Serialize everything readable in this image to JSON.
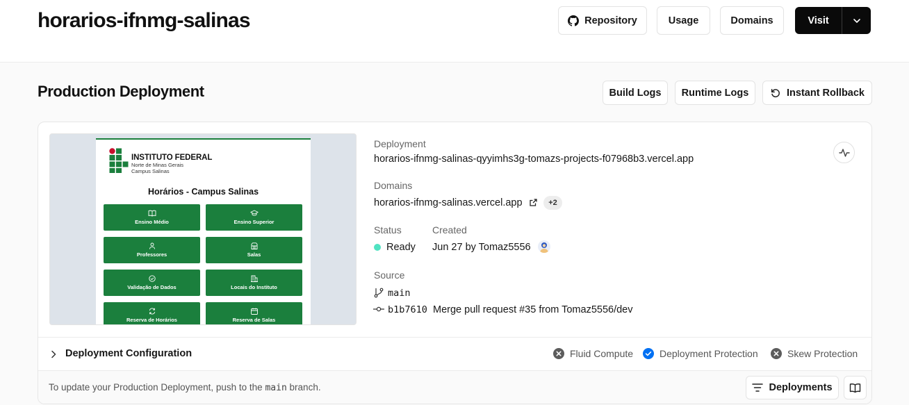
{
  "header": {
    "project_name": "horarios-ifnmg-salinas",
    "repository_label": "Repository",
    "usage_label": "Usage",
    "domains_label": "Domains",
    "visit_label": "Visit"
  },
  "production": {
    "title": "Production Deployment",
    "build_logs_label": "Build Logs",
    "runtime_logs_label": "Runtime Logs",
    "instant_rollback_label": "Instant Rollback"
  },
  "preview": {
    "institute_name": "INSTITUTO FEDERAL",
    "institute_sub1": "Norte de Minas Gerais",
    "institute_sub2": "Campus Salinas",
    "page_title": "Horários - Campus Salinas",
    "tiles": [
      {
        "label": "Ensino Médio",
        "icon": "book-icon"
      },
      {
        "label": "Ensino Superior",
        "icon": "graduation-cap-icon"
      },
      {
        "label": "Professores",
        "icon": "user-icon"
      },
      {
        "label": "Salas",
        "icon": "door-icon"
      },
      {
        "label": "Validação de Dados",
        "icon": "check-circle-icon"
      },
      {
        "label": "Locais do Instituto",
        "icon": "building-icon"
      },
      {
        "label": "Reserva de Horários",
        "icon": "refresh-icon"
      },
      {
        "label": "Reserva de Salas",
        "icon": "calendar-icon"
      }
    ]
  },
  "deployment": {
    "deployment_label": "Deployment",
    "deployment_url": "horarios-ifnmg-salinas-qyyimhs3g-tomazs-projects-f07968b3.vercel.app",
    "domains_label": "Domains",
    "domain": "horarios-ifnmg-salinas.vercel.app",
    "extra_domains": "+2",
    "status_label": "Status",
    "status_value": "Ready",
    "status_color": "#50e3c2",
    "created_label": "Created",
    "created_value": "Jun 27 by Tomaz5556",
    "source_label": "Source",
    "branch": "main",
    "commit_hash": "b1b7610",
    "commit_message": "Merge pull request #35 from Tomaz5556/dev"
  },
  "config": {
    "label": "Deployment Configuration",
    "fluid_compute": "Fluid Compute",
    "deployment_protection": "Deployment Protection",
    "skew_protection": "Skew Protection",
    "enabled_color": "#0070f3",
    "disabled_color": "#5c5c5c"
  },
  "footer": {
    "text_before": "To update your Production Deployment, push to the",
    "branch": "main",
    "text_after": "branch.",
    "deployments_label": "Deployments"
  }
}
